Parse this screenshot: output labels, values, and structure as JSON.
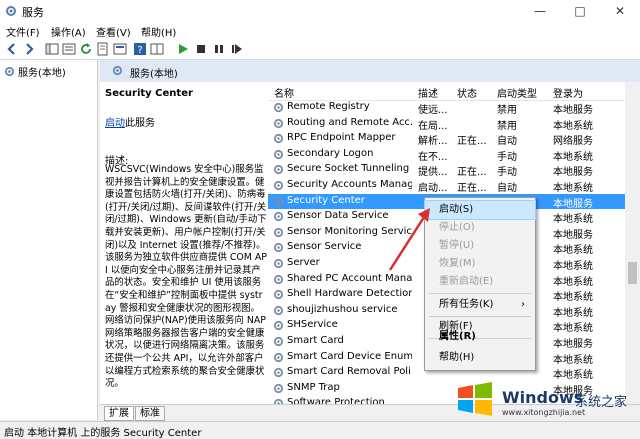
{
  "window": {
    "title": "服务"
  },
  "menu": [
    "文件(F)",
    "操作(A)",
    "查看(V)",
    "帮助(H)"
  ],
  "tree": {
    "root_label": "服务(本地)"
  },
  "pane": {
    "header": "服务(本地)"
  },
  "description": {
    "service_name": "Security Center",
    "start_link": "启动",
    "start_suffix": "此服务",
    "label": "描述:",
    "text": "WSCSVC(Windows 安全中心)服务监视并报告计算机上的安全健康设置。健康设置包括防火墙(打开/关闭)、防病毒(打开/关闭/过期)、反间谍软件(打开/关闭/过期)、Windows 更新(自动/手动下载并安装更新)、用户帐户控制(打开/关闭)以及 Internet 设置(推荐/不推荐)。该服务为独立软件供应商提供 COM API 以便向安全中心服务注册并记录其产品的状态。安全和维护 UI 使用该服务在“安全和维护”控制面板中提供 systray 警报和安全健康状况的图形视图。网络访问保护(NAP)使用该服务向 NAP 网络策略服务器报告客户端的安全健康状况，以便进行网络隔离决策。该服务还提供一个公共 API，以允许外部客户以编程方式检索系统的聚合安全健康状况。"
  },
  "columns": {
    "name": "名称",
    "desc": "描述",
    "status": "状态",
    "type": "启动类型",
    "logon": "登录为"
  },
  "services": [
    {
      "name": "Remote Registry",
      "desc": "使远...",
      "status": "",
      "type": "禁用",
      "logon": "本地服务"
    },
    {
      "name": "Routing and Remote Acc...",
      "desc": "在局...",
      "status": "",
      "type": "禁用",
      "logon": "本地系统"
    },
    {
      "name": "RPC Endpoint Mapper",
      "desc": "解析...",
      "status": "正在...",
      "type": "自动",
      "logon": "网络服务"
    },
    {
      "name": "Secondary Logon",
      "desc": "在不...",
      "status": "",
      "type": "手动",
      "logon": "本地系统"
    },
    {
      "name": "Secure Socket Tunneling ...",
      "desc": "提供...",
      "status": "正在...",
      "type": "手动",
      "logon": "本地服务"
    },
    {
      "name": "Security Accounts Manag...",
      "desc": "启动...",
      "status": "正在...",
      "type": "自动",
      "logon": "本地系统"
    },
    {
      "name": "Security Center",
      "desc": "",
      "status": "",
      "type": "",
      "logon": "本地服务"
    },
    {
      "name": "Sensor Data Service",
      "desc": "",
      "status": "",
      "type": "",
      "logon": "本地系统"
    },
    {
      "name": "Sensor Monitoring Service",
      "desc": "",
      "status": "",
      "type": "",
      "logon": "本地服务"
    },
    {
      "name": "Sensor Service",
      "desc": "",
      "status": "",
      "type": "",
      "logon": "本地系统"
    },
    {
      "name": "Server",
      "desc": "",
      "status": "",
      "type": "",
      "logon": "本地系统"
    },
    {
      "name": "Shared PC Account Mana...",
      "desc": "",
      "status": "",
      "type": "",
      "logon": "本地系统"
    },
    {
      "name": "Shell Hardware Detection",
      "desc": "",
      "status": "",
      "type": "",
      "logon": "本地系统"
    },
    {
      "name": "shoujizhushou service",
      "desc": "",
      "status": "",
      "type": "",
      "logon": "本地系统"
    },
    {
      "name": "SHService",
      "desc": "",
      "status": "",
      "type": "",
      "logon": "本地系统"
    },
    {
      "name": "Smart Card",
      "desc": "",
      "status": "",
      "type": "",
      "logon": "本地服务"
    },
    {
      "name": "Smart Card Device Enum...",
      "desc": "",
      "status": "",
      "type": "",
      "logon": "本地系统"
    },
    {
      "name": "Smart Card Removal Poli...",
      "desc": "",
      "status": "",
      "type": "",
      "logon": "本地系统"
    },
    {
      "name": "SNMP Trap",
      "desc": "",
      "status": "",
      "type": "",
      "logon": "本地服务"
    },
    {
      "name": "Software Protection",
      "desc": "",
      "status": "",
      "type": "",
      "logon": ""
    }
  ],
  "context_menu": {
    "start": "启动(S)",
    "stop": "停止(O)",
    "pause": "暂停(U)",
    "resume": "恢复(M)",
    "restart": "重新启动(E)",
    "all_tasks": "所有任务(K)",
    "refresh": "刷新(F)",
    "properties": "属性(R)",
    "help": "帮助(H)"
  },
  "tabs": {
    "extended": "扩展",
    "standard": "标准"
  },
  "status_bar": "启动 本地计算机 上的服务 Security Center",
  "watermark": {
    "brand": "Windows",
    "text": "系统之家",
    "url": "www.xitongzhijia.net"
  }
}
